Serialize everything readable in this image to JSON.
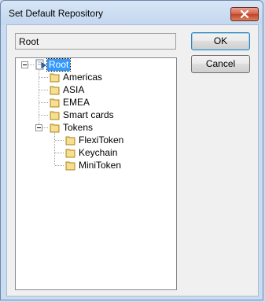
{
  "window": {
    "title": "Set Default Repository",
    "close_icon": "close-icon"
  },
  "path": {
    "value": "Root"
  },
  "buttons": {
    "ok_label": "OK",
    "cancel_label": "Cancel"
  },
  "tree": {
    "root": {
      "label": "Root",
      "icon": "repository-icon",
      "selected": true,
      "expanded": true
    },
    "items": [
      {
        "label": "Americas",
        "icon": "folder-icon"
      },
      {
        "label": "ASIA",
        "icon": "folder-icon"
      },
      {
        "label": "EMEA",
        "icon": "folder-icon"
      },
      {
        "label": "Smart cards",
        "icon": "folder-icon"
      },
      {
        "label": "Tokens",
        "icon": "folder-icon",
        "expanded": true,
        "children": [
          {
            "label": "FlexiToken",
            "icon": "folder-icon"
          },
          {
            "label": "Keychain",
            "icon": "folder-icon"
          },
          {
            "label": "MiniToken",
            "icon": "folder-icon"
          }
        ]
      }
    ]
  },
  "colors": {
    "selection": "#3399ff",
    "close_button": "#c94a2e",
    "folder": "#e8c45a"
  }
}
